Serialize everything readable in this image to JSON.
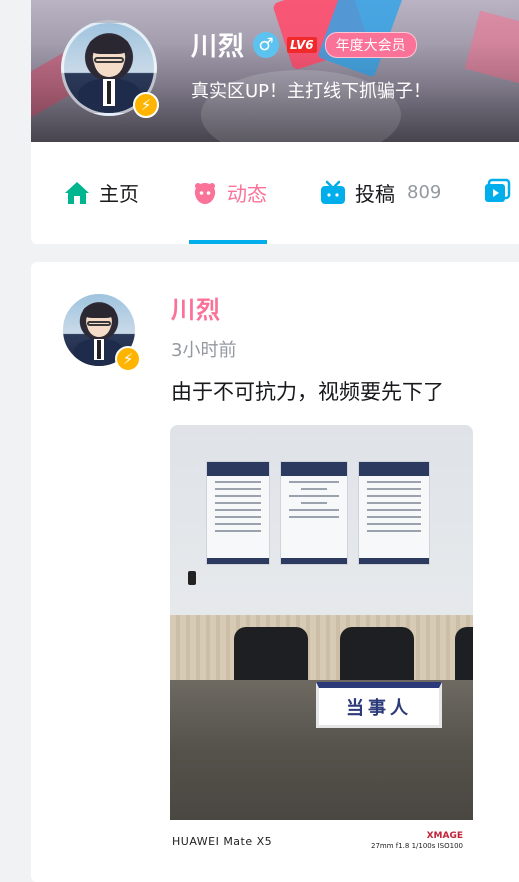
{
  "profile": {
    "name": "川烈",
    "gender_symbol": "♂",
    "level_label": "LV6",
    "vip_label": "年度大会员",
    "sign": "真实区UP！主打线下抓骗子！",
    "bolt_symbol": "⚡"
  },
  "tabs": [
    {
      "label": "主页",
      "icon": "home-icon",
      "color": "#00b58f"
    },
    {
      "label": "动态",
      "icon": "dynamic-icon",
      "color": "#fb7299",
      "active": true
    },
    {
      "label": "投稿",
      "count": "809",
      "icon": "tv-icon",
      "color": "#00aeec"
    },
    {
      "label": "",
      "icon": "collection-icon",
      "color": "#00aeec"
    }
  ],
  "post": {
    "author": "川烈",
    "time": "3小时前",
    "text": "由于不可抗力，视频要先下了",
    "image": {
      "nameplate": "当事人",
      "camera_model": "HUAWEI Mate X5",
      "camera_brand": "XMAGE",
      "camera_specs": "27mm  f1.8  1/100s  ISO100"
    }
  },
  "colors": {
    "accent_pink": "#fb7299",
    "accent_blue": "#00aeec",
    "vip_pink": "#fb7299",
    "level_red": "#f02a2a"
  }
}
